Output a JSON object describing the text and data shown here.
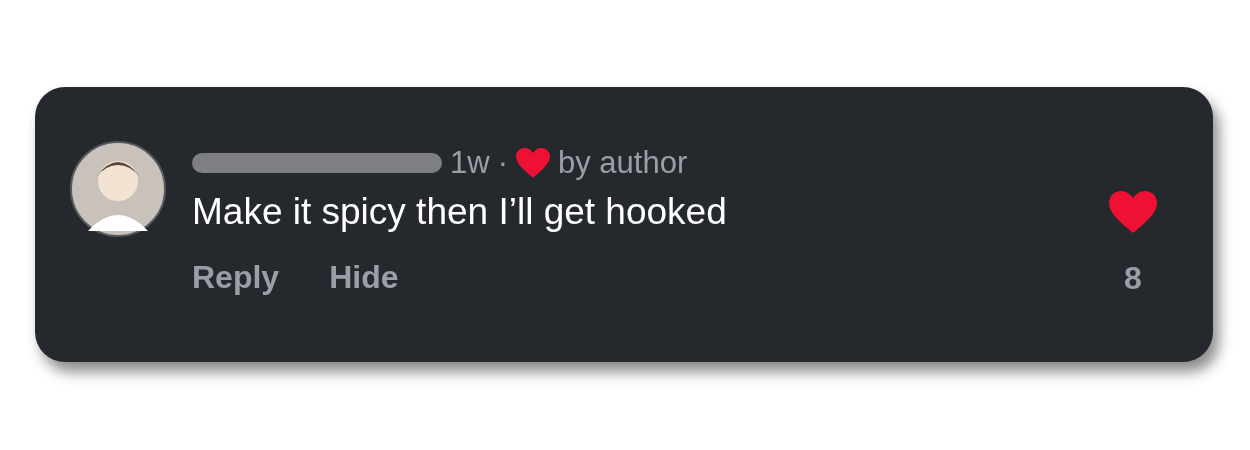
{
  "comment": {
    "time": "1w",
    "separator": "·",
    "liked_by_author": true,
    "author_label": "by author",
    "text": "Make it spicy then I’ll get hooked",
    "actions": [
      "Reply",
      "Hide"
    ],
    "liked": true,
    "like_count": "8"
  }
}
